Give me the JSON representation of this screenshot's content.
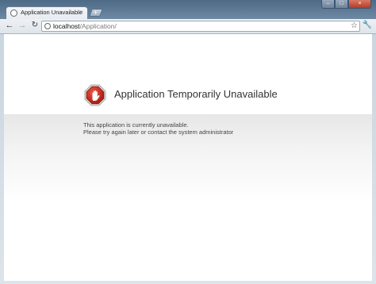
{
  "browser": {
    "tab": {
      "title": "Application Unavailable",
      "close_glyph": "×"
    },
    "new_tab_glyph": "+",
    "window_buttons": {
      "minimize": "–",
      "maximize": "□",
      "close": "×"
    },
    "toolbar": {
      "back_icon": "back-arrow-icon",
      "forward_icon": "forward-arrow-icon",
      "reload_icon": "reload-icon",
      "url_host": "localhost",
      "url_path": "/Application/",
      "bookmark_icon": "star-icon",
      "menu_icon": "wrench-icon"
    }
  },
  "page": {
    "icon": "stop-hand-icon",
    "heading": "Application Temporarily Unavailable",
    "message_line1": "This application is currently unavailable.",
    "message_line2": "Please try again later or contact the system administrator",
    "colors": {
      "icon_red": "#c8261c",
      "band_gray": "#e7e7e7"
    }
  }
}
